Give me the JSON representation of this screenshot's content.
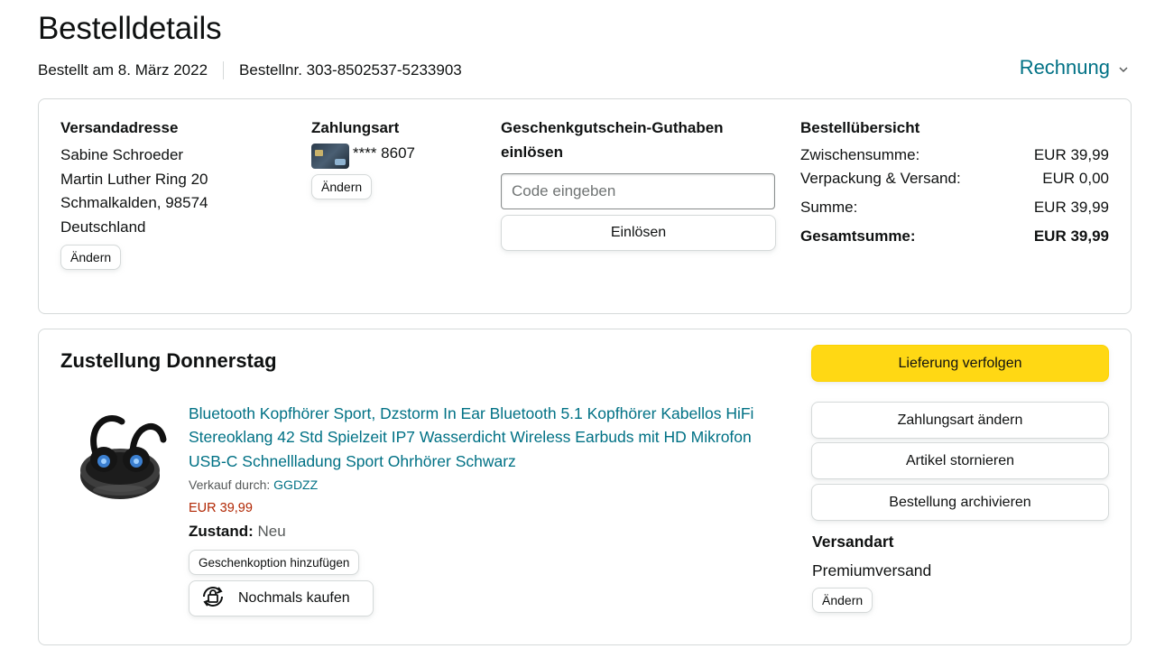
{
  "header": {
    "title": "Bestelldetails",
    "order_date": "Bestellt am 8. März 2022",
    "order_number": "Bestellnr. 303-8502537-5233903",
    "invoice_label": "Rechnung"
  },
  "shipping_address": {
    "heading": "Versandadresse",
    "lines": [
      "Sabine Schroeder",
      "Martin Luther Ring 20",
      "Schmalkalden, 98574",
      "Deutschland"
    ],
    "change_label": "Ändern"
  },
  "payment": {
    "heading": "Zahlungsart",
    "card_masked": "**** 8607",
    "change_label": "Ändern"
  },
  "gift_card": {
    "heading_line1": "Geschenkgutschein-Guthaben",
    "heading_line2": "einlösen",
    "input_placeholder": "Code eingeben",
    "redeem_label": "Einlösen"
  },
  "summary": {
    "heading": "Bestellübersicht",
    "rows": [
      {
        "label": "Zwischensumme:",
        "value": "EUR 39,99"
      },
      {
        "label": "Verpackung & Versand:",
        "value": "EUR 0,00"
      },
      {
        "label": "Summe:",
        "value": "EUR 39,99"
      },
      {
        "label": "Gesamtsumme:",
        "value": "EUR 39,99"
      }
    ]
  },
  "delivery": {
    "title": "Zustellung Donnerstag",
    "product": {
      "title": "Bluetooth Kopfhörer Sport, Dzstorm In Ear Bluetooth 5.1 Kopfhörer Kabellos HiFi Stereoklang 42 Std Spielzeit IP7 Wasserdicht Wireless Earbuds mit HD Mikrofon USB-C Schnellladung Sport Ohrhörer Schwarz",
      "seller_prefix": "Verkauf durch: ",
      "seller_name": "GGDZZ",
      "price": "EUR 39,99",
      "condition_label": "Zustand:",
      "condition_value": "Neu",
      "gift_option_label": "Geschenkoption hinzufügen",
      "buy_again_label": "Nochmals kaufen"
    },
    "actions": {
      "track": "Lieferung verfolgen",
      "change_payment": "Zahlungsart ändern",
      "cancel": "Artikel stornieren",
      "archive": "Bestellung archivieren"
    },
    "shipping_mode": {
      "heading": "Versandart",
      "value": "Premiumversand",
      "change_label": "Ändern"
    }
  },
  "colors": {
    "link": "#007185",
    "price": "#B12704",
    "primary_button": "#FFD814",
    "border": "#D5D9D9"
  }
}
